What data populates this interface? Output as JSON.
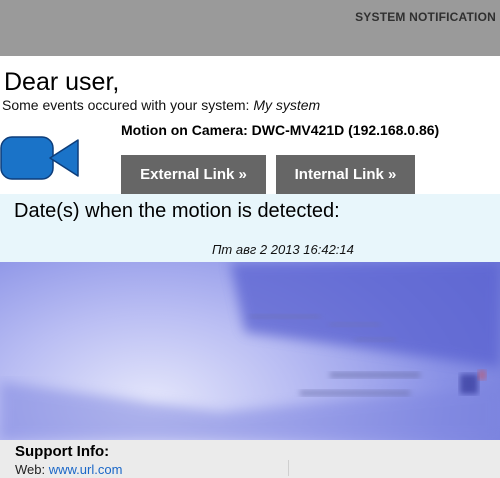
{
  "header": {
    "title": "SYSTEM NOTIFICATION"
  },
  "greeting": "Dear user,",
  "events": {
    "prefix": "Some events occured with your system:",
    "system_name": "My system"
  },
  "camera": {
    "icon": "video-camera-icon",
    "icon_color": "#1a73c8",
    "motion_text": "Motion on Camera: DWC-MV421D (192.168.0.86)"
  },
  "buttons": {
    "external_label": "External Link »",
    "internal_label": "Internal Link »",
    "color": "#666666"
  },
  "dates": {
    "title": "Date(s) when the motion is detected:",
    "values": [
      "Пт авг 2 2013 16:42:14"
    ]
  },
  "snapshot": {
    "type": "camera-snapshot-image"
  },
  "support": {
    "title": "Support Info:",
    "web_label": "Web:",
    "web_url": "www.url.com",
    "link_color": "#1a67c8"
  }
}
